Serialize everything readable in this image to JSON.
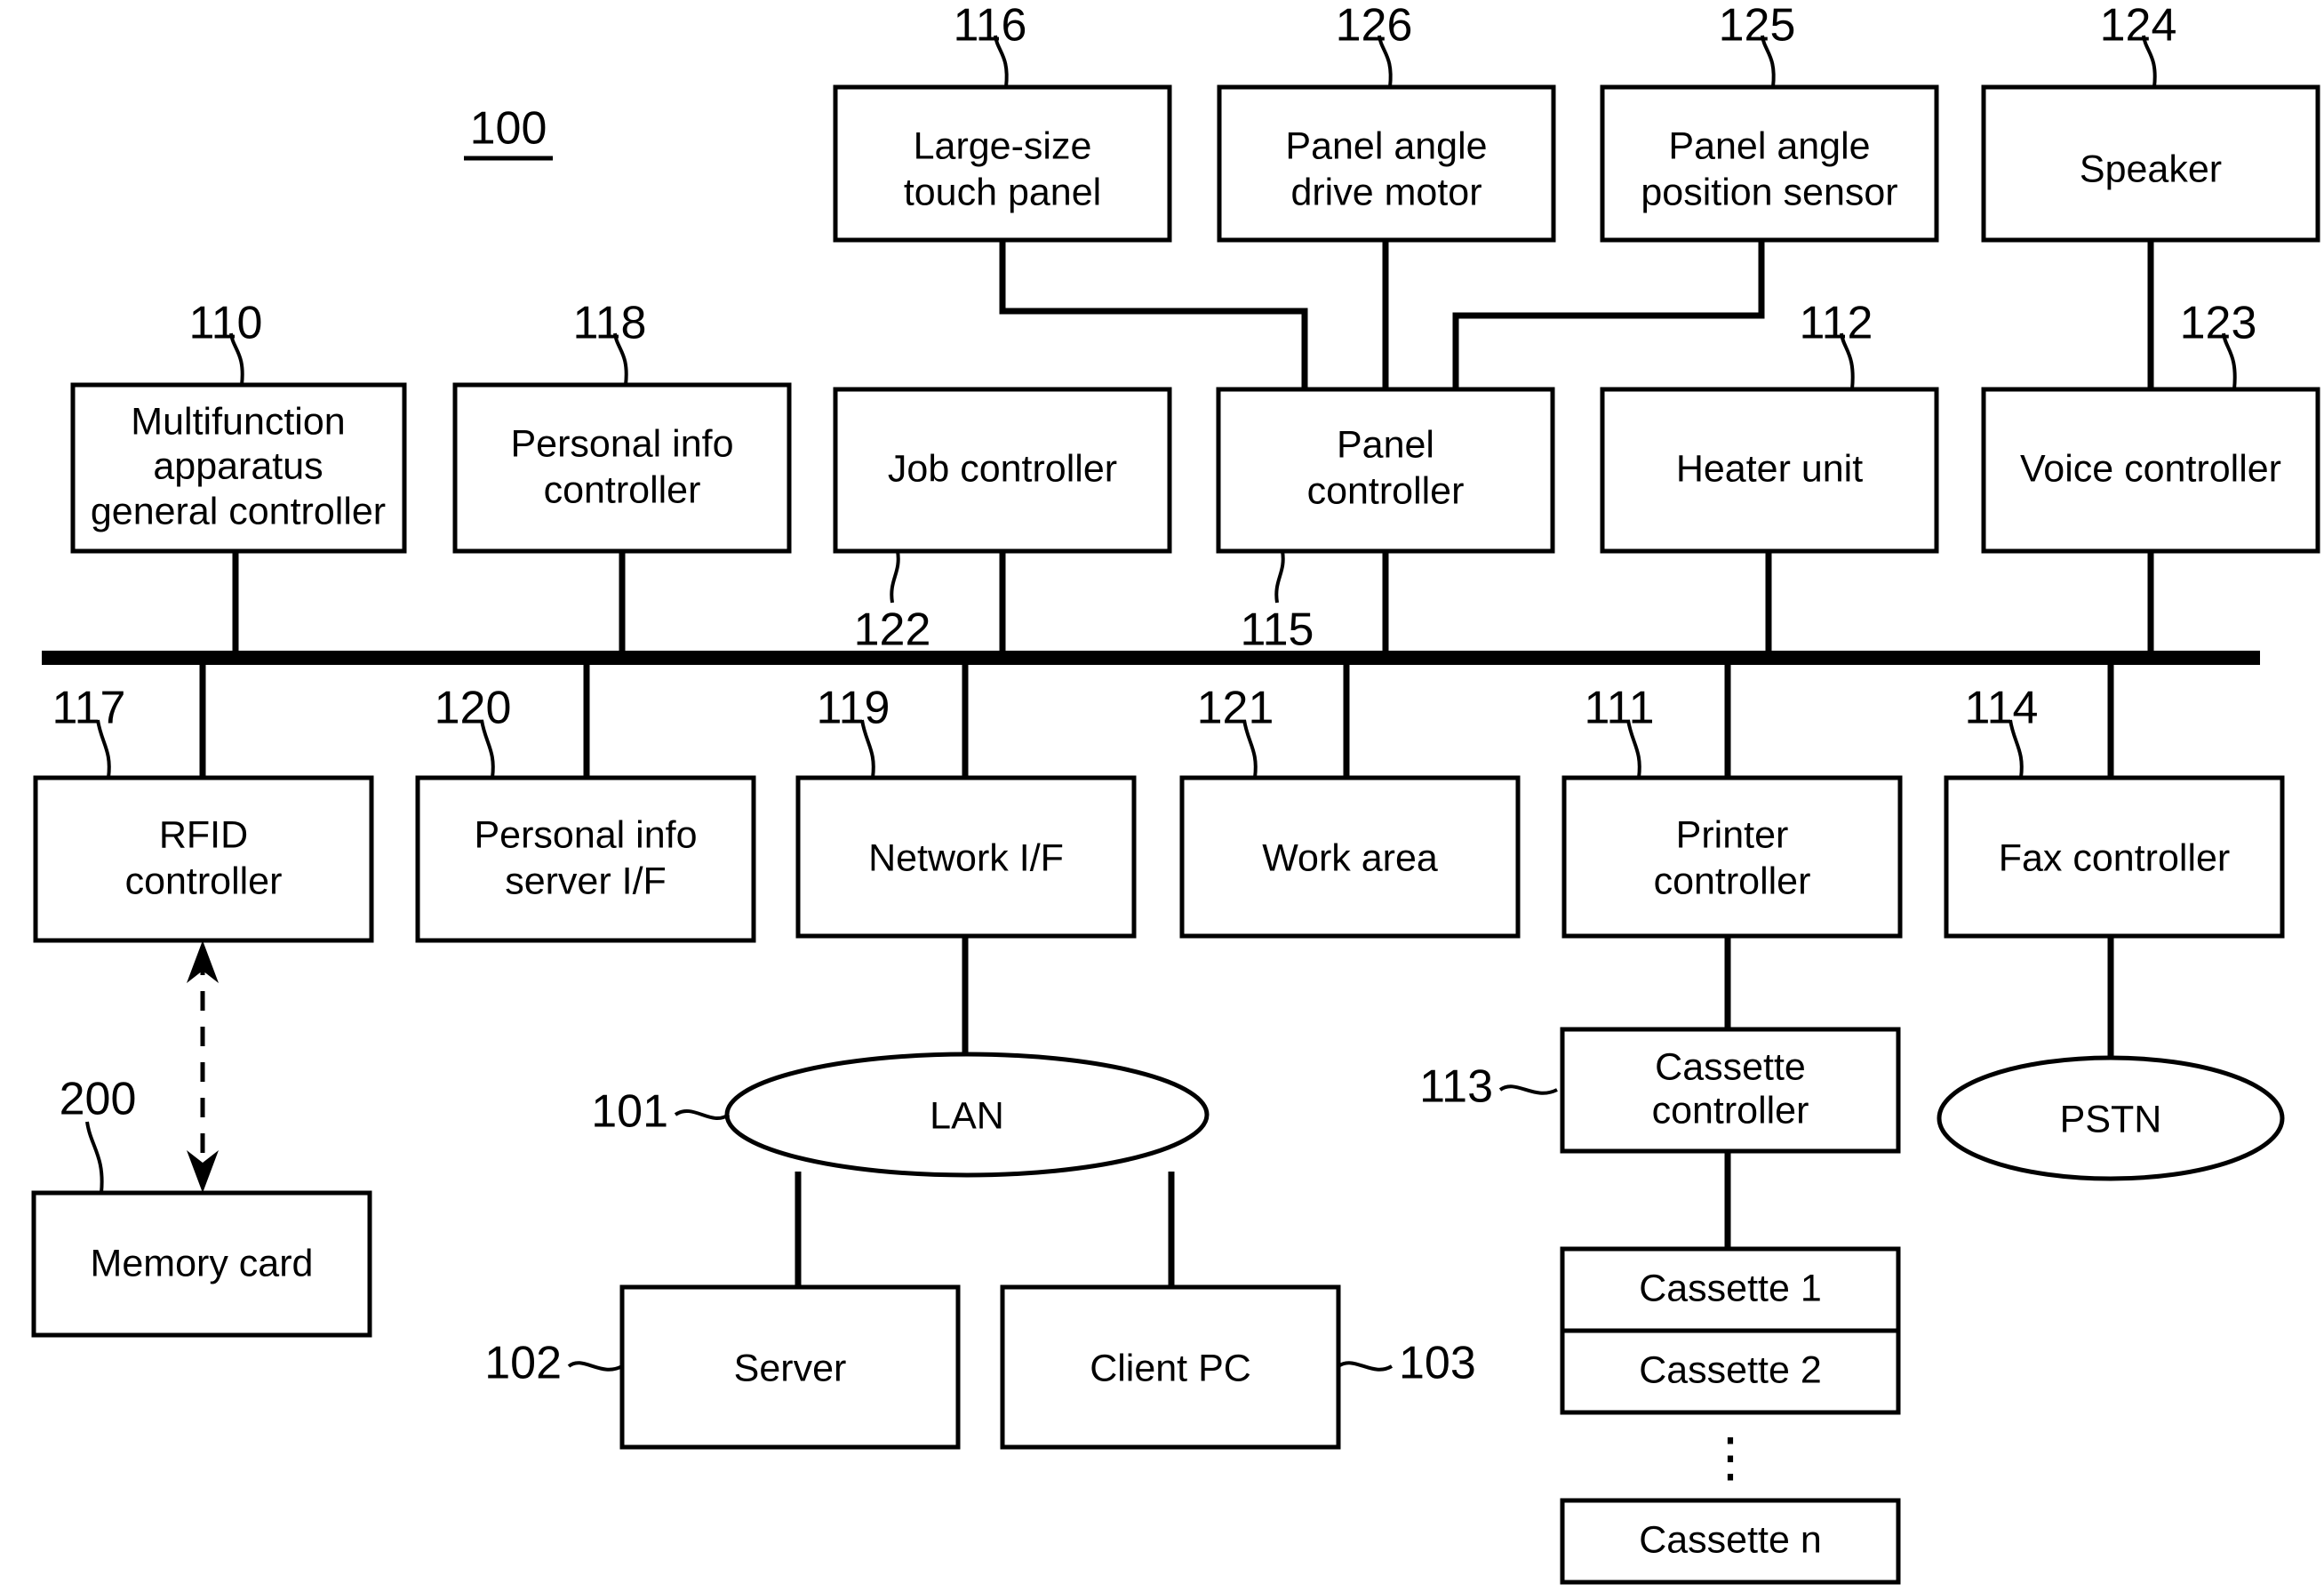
{
  "figure": {
    "number": "100",
    "underlined": true
  },
  "nodes": {
    "large_size_touch_panel": {
      "ref": "116",
      "label_line1": "Large-size",
      "label_line2": "touch panel"
    },
    "panel_angle_drive_motor": {
      "ref": "126",
      "label_line1": "Panel angle",
      "label_line2": "drive motor"
    },
    "panel_angle_position_sensor": {
      "ref": "125",
      "label_line1": "Panel angle",
      "label_line2": "position sensor"
    },
    "speaker": {
      "ref": "124",
      "label_line1": "Speaker",
      "label_line2": ""
    },
    "multifunction_general_controller": {
      "ref": "110",
      "label_line1": "Multifunction",
      "label_line2": "apparatus",
      "label_line3": "general controller"
    },
    "personal_info_controller": {
      "ref": "118",
      "label_line1": "Personal info",
      "label_line2": "controller"
    },
    "job_controller": {
      "ref": "122",
      "label_line1": "Job controller",
      "label_line2": ""
    },
    "panel_controller": {
      "ref": "115",
      "label_line1": "Panel",
      "label_line2": "controller"
    },
    "heater_unit": {
      "ref": "112",
      "label_line1": "Heater unit",
      "label_line2": ""
    },
    "voice_controller": {
      "ref": "123",
      "label_line1": "Voice controller",
      "label_line2": ""
    },
    "rfid_controller": {
      "ref": "117",
      "label_line1": "RFID",
      "label_line2": "controller"
    },
    "personal_info_server_if": {
      "ref": "120",
      "label_line1": "Personal info",
      "label_line2": "server I/F"
    },
    "network_if": {
      "ref": "119",
      "label_line1": "Network I/F",
      "label_line2": ""
    },
    "work_area": {
      "ref": "121",
      "label_line1": "Work area",
      "label_line2": ""
    },
    "printer_controller": {
      "ref": "111",
      "label_line1": "Printer",
      "label_line2": "controller"
    },
    "fax_controller": {
      "ref": "114",
      "label_line1": "Fax controller",
      "label_line2": ""
    },
    "memory_card": {
      "ref": "200",
      "label_line1": "Memory card",
      "label_line2": ""
    },
    "lan": {
      "ref": "101",
      "label_line1": "LAN",
      "label_line2": ""
    },
    "server": {
      "ref": "102",
      "label_line1": "Server",
      "label_line2": ""
    },
    "client_pc": {
      "ref": "103",
      "label_line1": "Client PC",
      "label_line2": ""
    },
    "pstn": {
      "ref": "",
      "label_line1": "PSTN",
      "label_line2": ""
    },
    "cassette_controller": {
      "ref": "113",
      "label_line1": "Cassette",
      "label_line2": "controller"
    },
    "cassette_1": {
      "ref": "",
      "label_line1": "Cassette 1",
      "label_line2": ""
    },
    "cassette_2": {
      "ref": "",
      "label_line1": "Cassette 2",
      "label_line2": ""
    },
    "cassette_n": {
      "ref": "",
      "label_line1": "Cassette n",
      "label_line2": ""
    },
    "cassette_ellipsis": {
      "ref": "",
      "label_line1": "⋮",
      "label_line2": ""
    }
  },
  "colors": {
    "stroke": "#000000",
    "fill": "#ffffff"
  }
}
